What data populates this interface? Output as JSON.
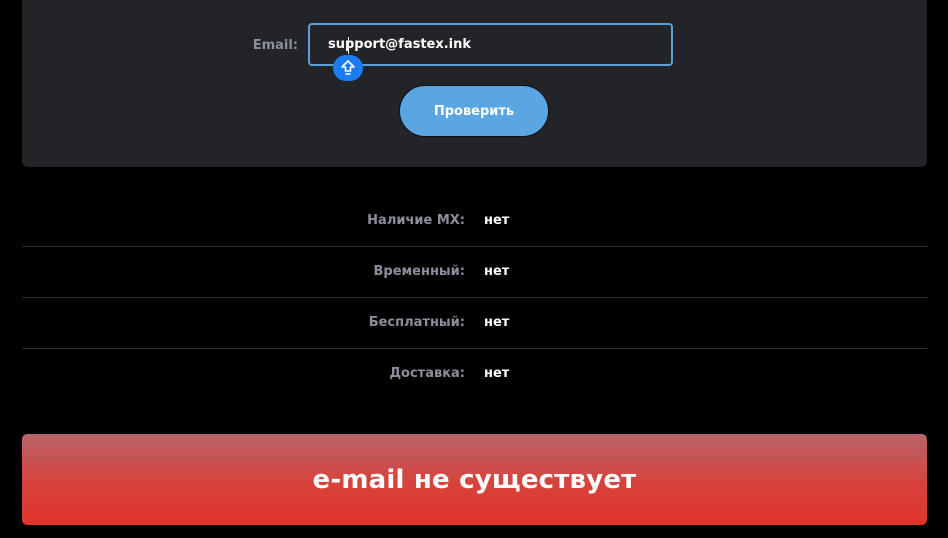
{
  "form": {
    "email_label": "Email:",
    "email_value": "support@fastex.ink",
    "upload_icon": "arrow-up-icon",
    "submit_label": "Проверить"
  },
  "results": [
    {
      "label": "Наличие MX:",
      "value": "нет"
    },
    {
      "label": "Временный:",
      "value": "нет"
    },
    {
      "label": "Бесплатный:",
      "value": "нет"
    },
    {
      "label": "Доставка:",
      "value": "нет"
    }
  ],
  "verdict": {
    "text": "e-mail не существует",
    "color": "#e0332a"
  },
  "colors": {
    "accent": "#5aa6e2",
    "panel": "#222428",
    "label": "#8b8f9c"
  }
}
